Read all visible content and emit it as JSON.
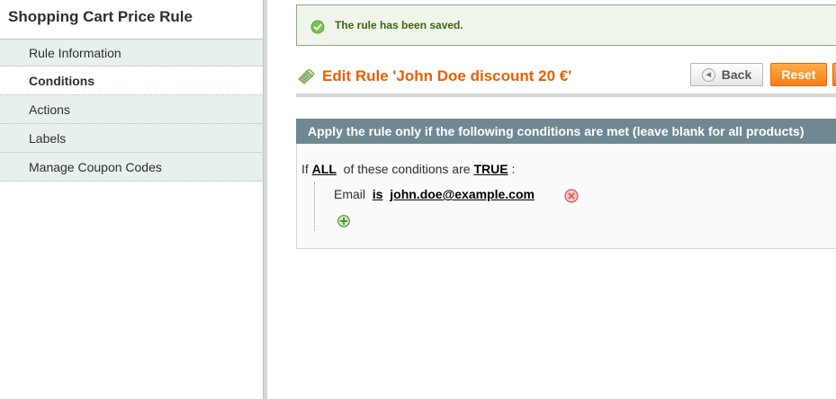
{
  "sidebar": {
    "title": "Shopping Cart Price Rule",
    "tabs": [
      {
        "label": "Rule Information"
      },
      {
        "label": "Conditions"
      },
      {
        "label": "Actions"
      },
      {
        "label": "Labels"
      },
      {
        "label": "Manage Coupon Codes"
      }
    ],
    "active_tab": "Conditions"
  },
  "message": {
    "text": "The rule has been saved.",
    "icon": "success-check-icon"
  },
  "header": {
    "title": "Edit Rule 'John Doe discount 20 €'",
    "icon": "edit-rule-icon",
    "back_label": "Back",
    "reset_label": "Reset"
  },
  "conditions": {
    "heading": "Apply the rule only if the following conditions are met (leave blank for all products)",
    "intro_prefix": "If",
    "aggregator": "ALL",
    "intro_middle": "of these conditions are",
    "value": "TRUE",
    "intro_suffix": ":",
    "rule": {
      "attribute": "Email",
      "operator": "is",
      "value": "john.doe@example.com"
    }
  },
  "colors": {
    "accent_orange": "#eb5e00",
    "success_green": "#3d6611",
    "fieldset_header": "#6f8992"
  }
}
